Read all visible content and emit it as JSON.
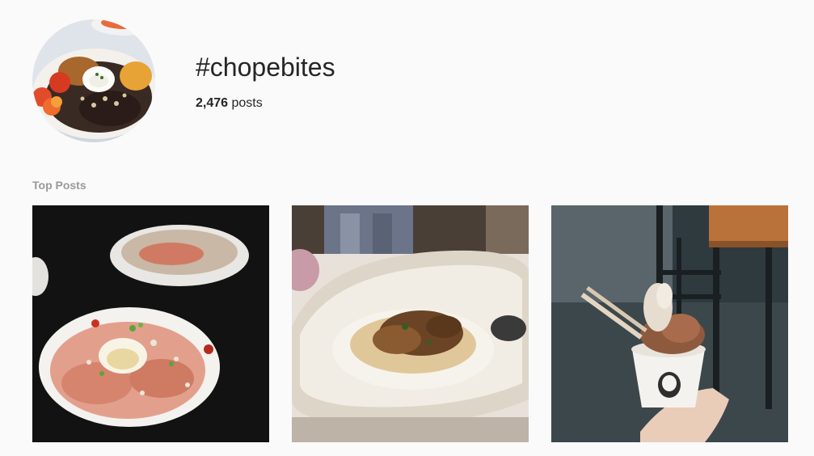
{
  "header": {
    "hashtag": "#chopebites",
    "post_count": "2,476",
    "post_count_suffix": " posts"
  },
  "top_posts": {
    "label": "Top Posts",
    "posts": [
      {
        "alt": "Bowl of salad with ham, poached egg and grated cheese"
      },
      {
        "alt": "Plate of mushrooms over creamy puree"
      },
      {
        "alt": "Hand holding a cup of ice cream"
      }
    ]
  }
}
